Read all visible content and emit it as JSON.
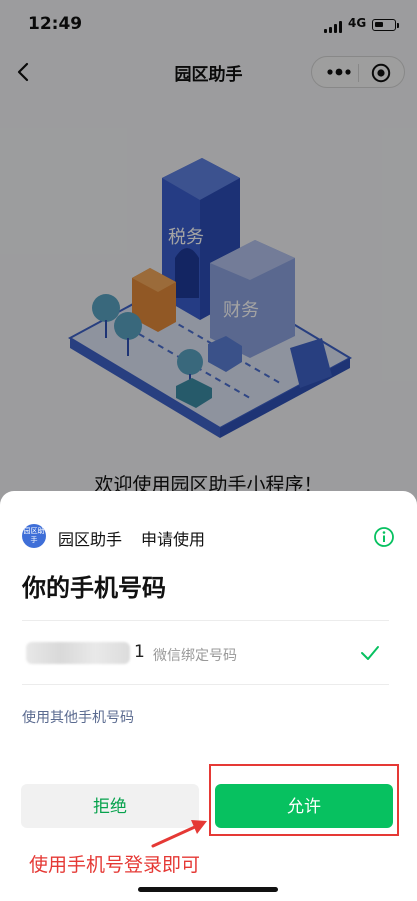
{
  "status_bar": {
    "time": "12:49",
    "network": "4G"
  },
  "navbar": {
    "title": "园区助手"
  },
  "hero": {
    "building1_label": "税务",
    "building2_label": "财务"
  },
  "welcome_text": "欢迎使用园区助手小程序！",
  "sheet": {
    "app_logo_text": "园区助手",
    "app_name": "园区助手",
    "request_text": "申请使用",
    "title": "你的手机号码",
    "phone_visible_digit": "1",
    "phone_tag": "微信绑定号码",
    "other_phone_link": "使用其他手机号码",
    "reject_label": "拒绝",
    "allow_label": "允许"
  },
  "annotation": {
    "text": "使用手机号登录即可",
    "color": "#e53935"
  },
  "colors": {
    "accent_green": "#07c160",
    "reject_text": "#07a24d",
    "link": "#5b6b90"
  }
}
